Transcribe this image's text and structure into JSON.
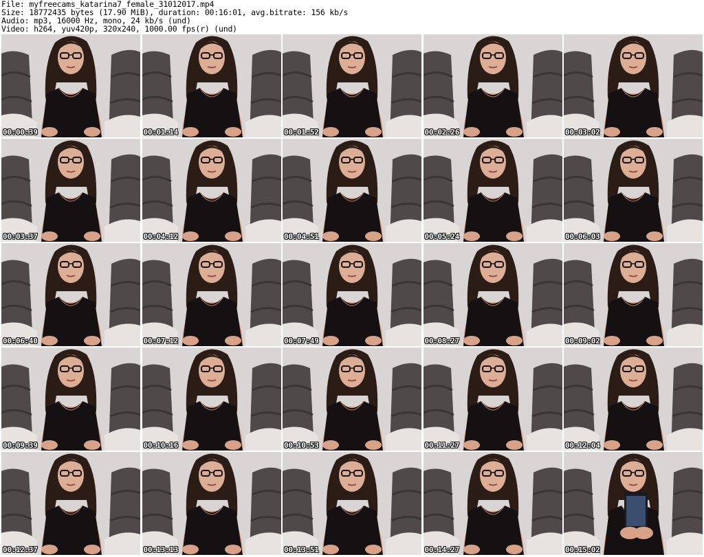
{
  "header": {
    "file_line": "File: myfreecams_katarina7_female_31012017.mp4",
    "size_line": "Size: 18772435 bytes (17.90 MiB), duration: 00:16:01, avg.bitrate: 156 kb/s",
    "audio_line": "Audio: mp3, 16000 Hz, mono, 24 kb/s (und)",
    "video_line": "Video: h264, yuv420p, 320x240, 1000.00 fps(r) (und)"
  },
  "thumbnails": [
    {
      "timestamp": "00:00:39"
    },
    {
      "timestamp": "00:01:14"
    },
    {
      "timestamp": "00:01:52"
    },
    {
      "timestamp": "00:02:26"
    },
    {
      "timestamp": "00:03:02"
    },
    {
      "timestamp": "00:03:37"
    },
    {
      "timestamp": "00:04:12"
    },
    {
      "timestamp": "00:04:51"
    },
    {
      "timestamp": "00:05:24"
    },
    {
      "timestamp": "00:06:03"
    },
    {
      "timestamp": "00:06:40"
    },
    {
      "timestamp": "00:07:12"
    },
    {
      "timestamp": "00:07:49"
    },
    {
      "timestamp": "00:08:27"
    },
    {
      "timestamp": "00:09:02"
    },
    {
      "timestamp": "00:09:39"
    },
    {
      "timestamp": "00:10:16"
    },
    {
      "timestamp": "00:10:53"
    },
    {
      "timestamp": "00:11:27"
    },
    {
      "timestamp": "00:12:04"
    },
    {
      "timestamp": "00:12:37"
    },
    {
      "timestamp": "00:13:13"
    },
    {
      "timestamp": "00:13:51"
    },
    {
      "timestamp": "00:14:27"
    },
    {
      "timestamp": "00:15:02"
    }
  ],
  "colors": {
    "background": "#ffffff",
    "wall": "#d6d3d2",
    "couch": "#4a4646",
    "hair": "#2a1a14",
    "skin": "#d9a58c",
    "top": "#141012",
    "timestamp_text": "#ffffff"
  },
  "icons": {
    "phone": "smartphone-icon"
  }
}
